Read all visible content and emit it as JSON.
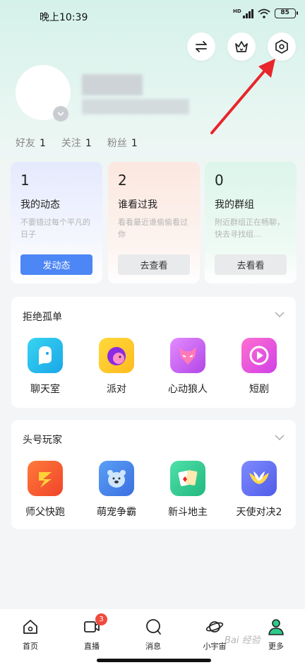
{
  "status_bar": {
    "time": "晚上10:39",
    "signal_label": "HD",
    "battery": "85"
  },
  "profile": {
    "stats": [
      {
        "label": "好友",
        "value": "1"
      },
      {
        "label": "关注",
        "value": "1"
      },
      {
        "label": "粉丝",
        "value": "1"
      }
    ]
  },
  "cards": [
    {
      "count": "1",
      "title": "我的动态",
      "desc": "不要错过每个平凡的日子",
      "button": "发动态"
    },
    {
      "count": "2",
      "title": "谁看过我",
      "desc": "看看最近谁偷偷看过你",
      "button": "去查看"
    },
    {
      "count": "0",
      "title": "我的群组",
      "desc": "附近群组正在畅聊，快去寻找组...",
      "button": "去看看"
    }
  ],
  "sections": [
    {
      "title": "拒绝孤单",
      "apps": [
        "聊天室",
        "派对",
        "心动狼人",
        "短剧"
      ]
    },
    {
      "title": "头号玩家",
      "apps": [
        "师父快跑",
        "萌宠争霸",
        "新斗地主",
        "天使对决2"
      ]
    }
  ],
  "bottom_nav": {
    "items": [
      {
        "label": "首页",
        "icon": "home-icon"
      },
      {
        "label": "直播",
        "icon": "video-icon",
        "badge": "3"
      },
      {
        "label": "消息",
        "icon": "message-icon"
      },
      {
        "label": "小宇宙",
        "icon": "planet-icon"
      },
      {
        "label": "更多",
        "icon": "person-icon"
      }
    ]
  },
  "watermark": "Bai 经验",
  "colors": {
    "primary_button": "#4d86f5",
    "badge": "#f04b3f",
    "annotation_arrow": "#e8262b"
  }
}
